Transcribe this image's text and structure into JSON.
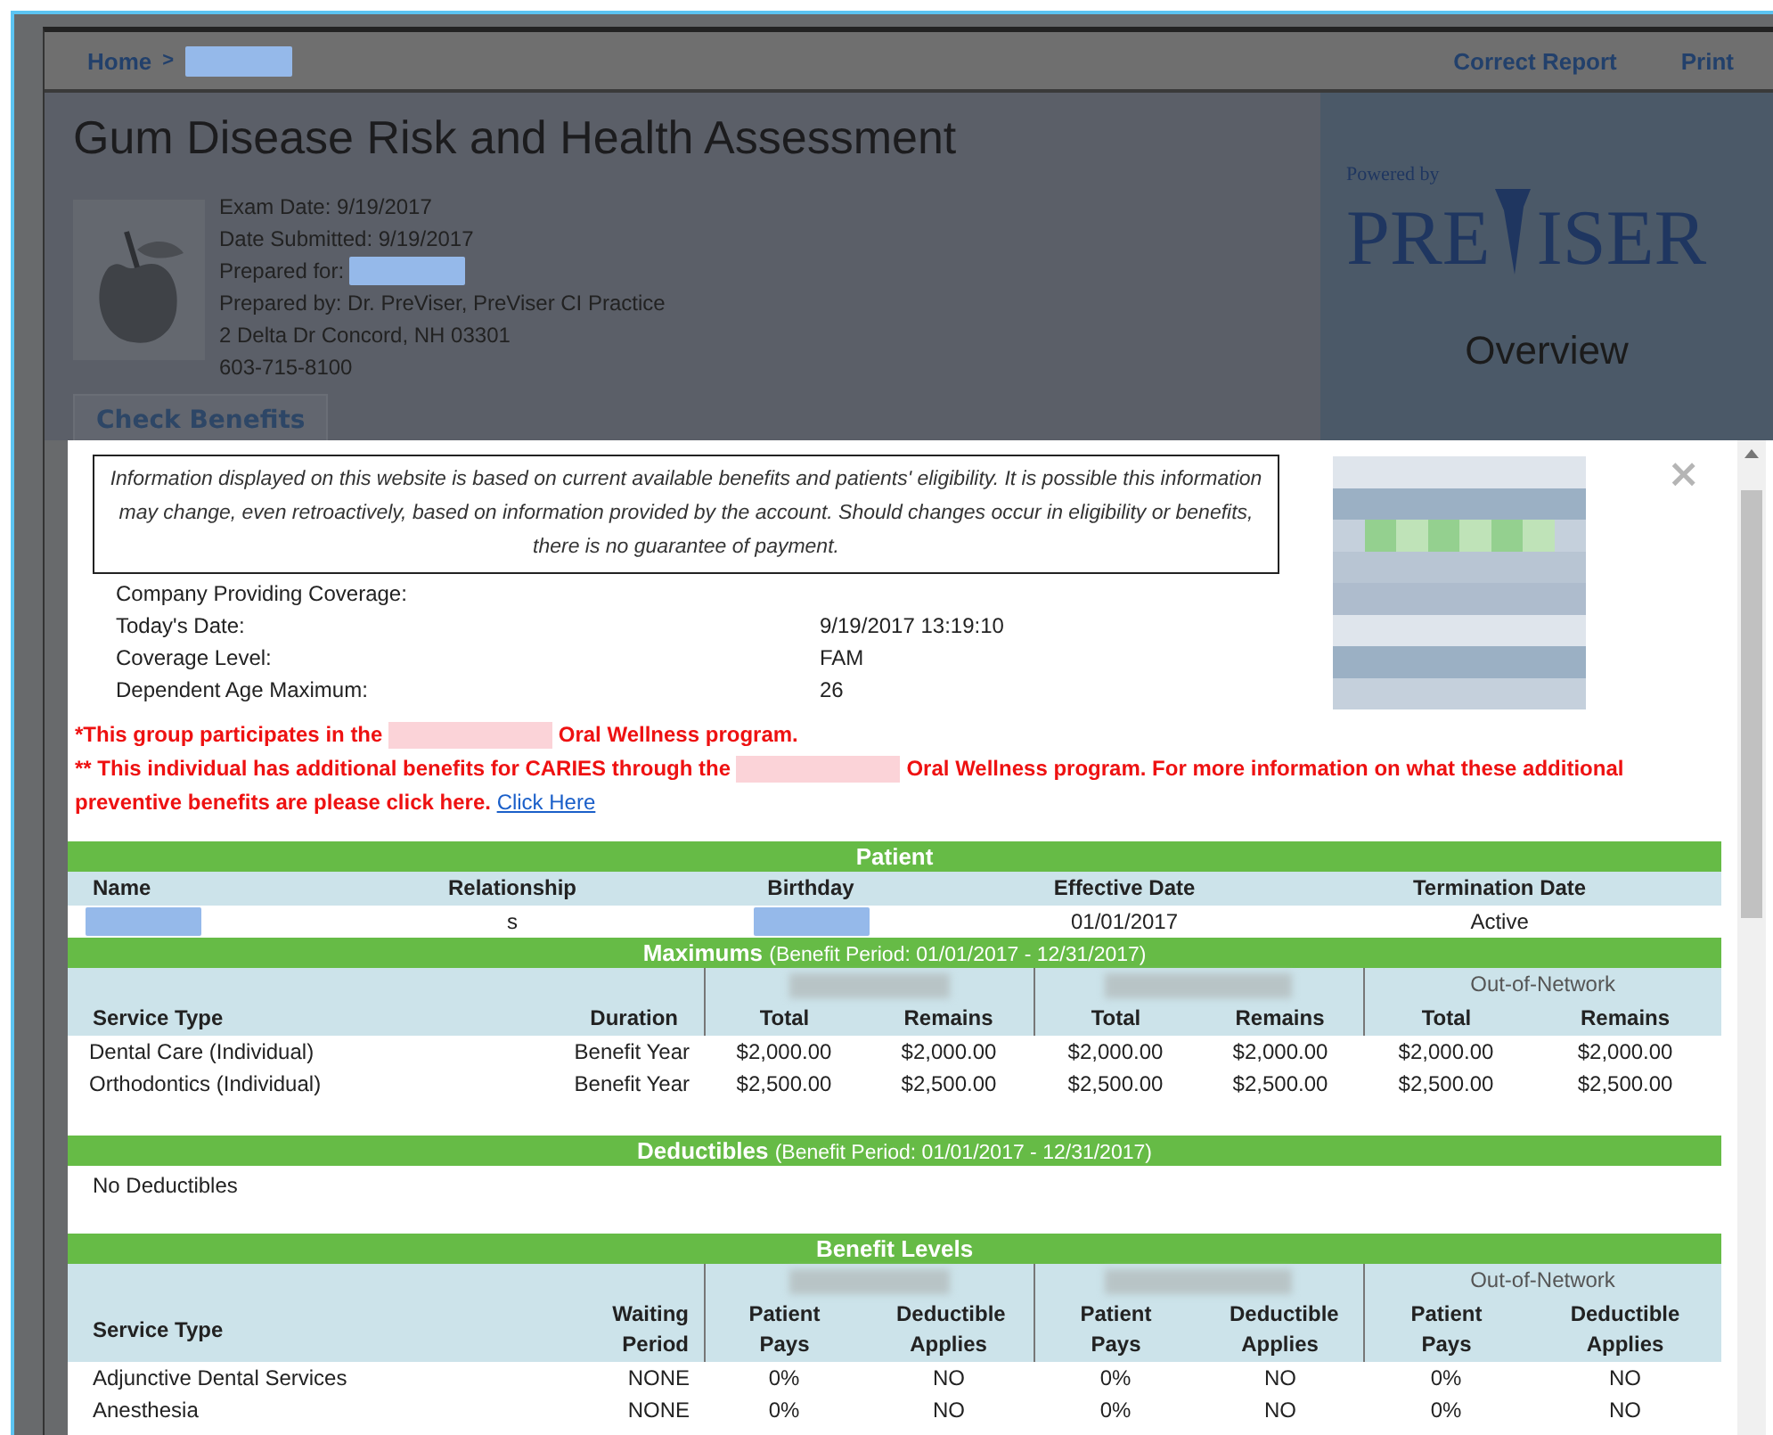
{
  "nav": {
    "home": "Home",
    "separator": ">",
    "links": [
      "Correct Report",
      "Print"
    ]
  },
  "header": {
    "title": "Gum Disease Risk and Health Assessment",
    "details": [
      {
        "text": "Exam Date: 9/19/2017",
        "redacted": false
      },
      {
        "text": "Date Submitted: 9/19/2017",
        "redacted": false
      },
      {
        "text": "Prepared for:",
        "redacted": true
      },
      {
        "text": "Prepared by: Dr. PreViser, PreViser CI Practice",
        "redacted": false
      },
      {
        "text": "2 Delta Dr  Concord, NH  03301",
        "redacted": false
      },
      {
        "text": "603-715-8100",
        "redacted": false
      }
    ],
    "tab": "Check Benefits",
    "powered_by": "Powered by",
    "brand_left": "PRE",
    "brand_right": "ISER",
    "panel_title": "Overview"
  },
  "modal": {
    "close": "×",
    "disclaimer": "Information displayed on this website is based on current available benefits and patients' eligibility. It is possible this information may change, even retroactively, based on information provided by the account. Should changes occur in eligibility or benefits, there is no guarantee of payment.",
    "coverage": [
      {
        "label": "Company Providing Coverage:"
      },
      {
        "label": "Today's Date:",
        "value": "9/19/2017 13:19:10"
      },
      {
        "label": "Coverage Level:",
        "value": "FAM"
      },
      {
        "label": "Dependent Age Maximum:",
        "value": "26"
      }
    ],
    "notices": [
      {
        "before": "*This group participates in the",
        "after": "Oral Wellness program."
      },
      {
        "before": "** This individual has additional benefits for CARIES through the",
        "after": "Oral Wellness program. For more information on what these additional preventive benefits are please click here.",
        "link": "Click Here"
      }
    ],
    "patient": {
      "title": "Patient",
      "columns": [
        "Name",
        "Relationship",
        "Birthday",
        "Effective Date",
        "Termination Date"
      ],
      "row": [
        {
          "kind": "redacted"
        },
        {
          "kind": "text",
          "text": "s"
        },
        {
          "kind": "redacted"
        },
        {
          "kind": "text",
          "text": "01/01/2017"
        },
        {
          "kind": "text",
          "text": "Active"
        }
      ]
    },
    "maximums": {
      "title": "Maximums",
      "subtitle": "(Benefit Period: 01/01/2017 - 12/31/2017)",
      "groups": [
        {
          "kind": "blurred"
        },
        {
          "kind": "blurred"
        },
        {
          "kind": "text",
          "text": "Out-of-Network"
        }
      ],
      "columns": [
        "Service Type",
        "Duration",
        "Total",
        "Remains",
        "Total",
        "Remains",
        "Total",
        "Remains"
      ],
      "rows": [
        [
          "Dental Care (Individual)",
          "Benefit Year",
          "$2,000.00",
          "$2,000.00",
          "$2,000.00",
          "$2,000.00",
          "$2,000.00",
          "$2,000.00"
        ],
        [
          "Orthodontics (Individual)",
          "Benefit Year",
          "$2,500.00",
          "$2,500.00",
          "$2,500.00",
          "$2,500.00",
          "$2,500.00",
          "$2,500.00"
        ]
      ]
    },
    "deductibles": {
      "title": "Deductibles",
      "subtitle": "(Benefit Period: 01/01/2017 - 12/31/2017)",
      "text": "No Deductibles"
    },
    "benefits": {
      "title": "Benefit Levels",
      "groups": [
        {
          "kind": "blurred"
        },
        {
          "kind": "blurred"
        },
        {
          "kind": "text",
          "text": "Out-of-Network"
        }
      ],
      "columns": [
        "Service Type",
        "Waiting Period",
        "Patient Pays",
        "Deductible Applies",
        "Patient Pays",
        "Deductible Applies",
        "Patient Pays",
        "Deductible Applies"
      ],
      "rows": [
        [
          "Adjunctive Dental Services",
          "NONE",
          "0%",
          "NO",
          "0%",
          "NO",
          "0%",
          "NO"
        ],
        [
          "Anesthesia",
          "NONE",
          "0%",
          "NO",
          "0%",
          "NO",
          "0%",
          "NO"
        ]
      ]
    }
  }
}
